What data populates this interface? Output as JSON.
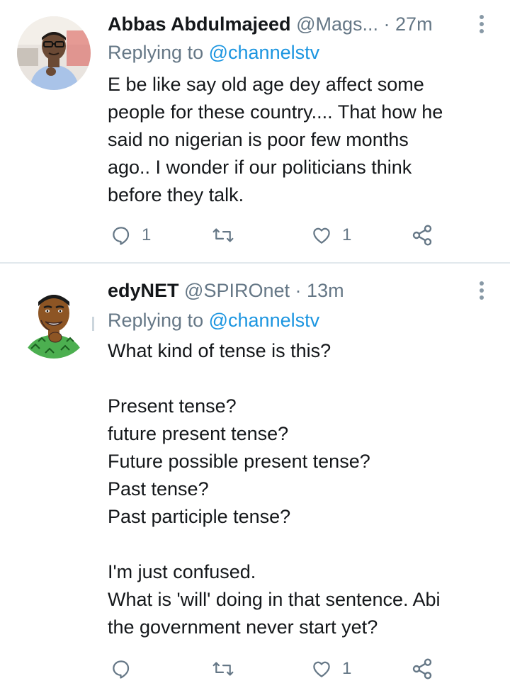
{
  "tweets": [
    {
      "author_name": "Abbas Abdulmajeed",
      "author_handle": "@Mags...",
      "dot": "·",
      "time": "27m",
      "replying_prefix": "Replying to",
      "replying_to": "@channelstv",
      "body_lines": [
        "E be like say old age dey affect some",
        "people for these country.... That how he",
        "said no nigerian is poor few months",
        "ago.. I wonder if our politicians think",
        "before they talk."
      ],
      "reply_count": "1",
      "retweet_count": "",
      "like_count": "1"
    },
    {
      "author_name": "edyNET",
      "author_handle": "@SPIROnet",
      "dot": "·",
      "time": "13m",
      "replying_prefix": "Replying to",
      "replying_to": "@channelstv",
      "body_lines": [
        "What kind of tense is this?",
        "",
        "Present tense?",
        "future present tense?",
        "Future possible present tense?",
        "Past tense?",
        "Past participle tense?",
        "",
        "I'm just confused.",
        "What is 'will' doing in that sentence. Abi",
        "the government never start yet?"
      ],
      "reply_count": "",
      "retweet_count": "",
      "like_count": "1"
    }
  ],
  "icons": {
    "reply": "reply-icon",
    "retweet": "retweet-icon",
    "like": "heart-icon",
    "share": "share-icon",
    "more": "more-vertical-icon"
  },
  "colors": {
    "text": "#14171a",
    "secondary": "#657786",
    "link": "#1b95e0",
    "divider": "#e1e8ed"
  }
}
